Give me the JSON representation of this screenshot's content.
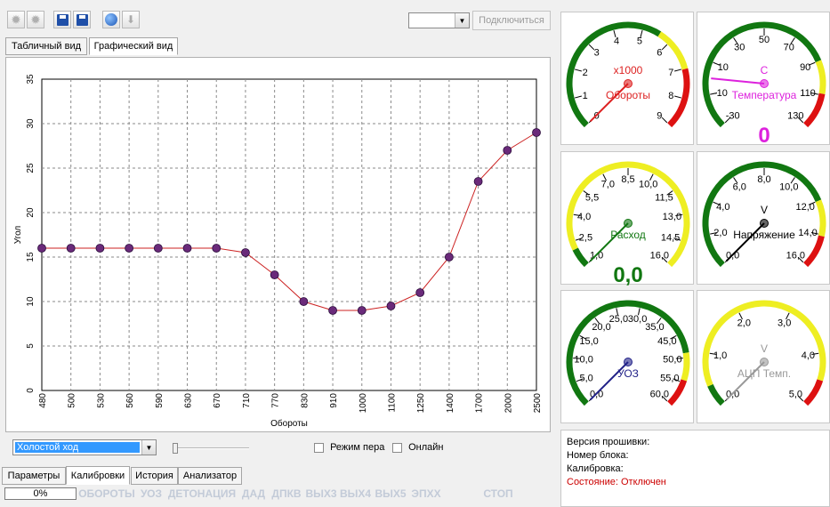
{
  "toolbar": {
    "icons": [
      "gear-left-icon",
      "gear-right-icon",
      "save-icon",
      "save-as-icon",
      "globe-icon",
      "download-icon"
    ],
    "port_value": "",
    "connect_label": "Подключиться"
  },
  "view_tabs": [
    {
      "label": "Табличный вид",
      "active": false
    },
    {
      "label": "Графический вид",
      "active": true
    }
  ],
  "chart_data": {
    "type": "line",
    "xlabel": "Обороты",
    "ylabel": "Угол",
    "x": [
      480,
      500,
      530,
      560,
      590,
      630,
      670,
      710,
      770,
      830,
      910,
      1000,
      1100,
      1250,
      1400,
      1700,
      2000,
      2500
    ],
    "y": [
      16,
      16,
      16,
      16,
      16,
      16,
      16,
      15.5,
      13,
      10,
      9,
      9,
      9.5,
      11,
      15,
      23.5,
      27,
      29
    ],
    "ylim": [
      0,
      35
    ],
    "yticks": [
      0,
      5,
      10,
      15,
      20,
      25,
      30,
      35
    ],
    "grid": true,
    "line_color": "#cc2222",
    "marker_color": "#6a2a7a"
  },
  "chart_controls": {
    "mode_select": "Холостой ход",
    "pen_mode_label": "Режим пера",
    "online_label": "Онлайн"
  },
  "bottom_tabs": [
    {
      "label": "Параметры",
      "active": false
    },
    {
      "label": "Калибровки",
      "active": true
    },
    {
      "label": "История",
      "active": false
    },
    {
      "label": "Анализатор",
      "active": false
    }
  ],
  "statusbar": {
    "progress_text": "0%",
    "progress": 0,
    "indicators": [
      "ОБОРОТЫ",
      "УОЗ",
      "ДЕТОНАЦИЯ",
      "ДАД",
      "ДПКВ",
      "ВЫХ3",
      "ВЫХ4",
      "ВЫХ5",
      "ЭПХХ",
      "СТОП"
    ]
  },
  "gauges": [
    {
      "id": "rpm",
      "label": "Обороты",
      "unit": "x1000",
      "min": 0,
      "max": 9,
      "ticks": [
        "0",
        "1",
        "2",
        "3",
        "4",
        "5",
        "6",
        "7",
        "8",
        "9"
      ],
      "value": 0,
      "readout": "",
      "color": "#dd2222",
      "bands": [
        [
          "#117711",
          0,
          0.62
        ],
        [
          "#eeee22",
          0.62,
          0.78
        ],
        [
          "#dd1111",
          0.78,
          1
        ]
      ]
    },
    {
      "id": "temp",
      "label": "Температура",
      "unit": "C",
      "min": -30,
      "max": 130,
      "ticks": [
        "-30",
        "-10",
        "10",
        "30",
        "50",
        "70",
        "90",
        "110",
        "130"
      ],
      "value": 0,
      "readout": "0",
      "color": "#dd22dd",
      "bands": [
        [
          "#117711",
          0,
          0.75
        ],
        [
          "#eeee22",
          0.75,
          0.87
        ],
        [
          "#dd1111",
          0.87,
          1
        ]
      ]
    },
    {
      "id": "flow",
      "label": "Расход",
      "unit": "",
      "min": 1,
      "max": 16,
      "ticks": [
        "1,0",
        "2,5",
        "4,0",
        "5,5",
        "7,0",
        "8,5",
        "10,0",
        "11,5",
        "13,0",
        "14,5",
        "16,0"
      ],
      "value": 1,
      "readout": "0,0",
      "color": "#117711",
      "bands": [
        [
          "#117711",
          0,
          0.07
        ],
        [
          "#eeee22",
          0.07,
          1
        ]
      ]
    },
    {
      "id": "volt",
      "label": "Напряжение",
      "unit": "V",
      "min": 0,
      "max": 16,
      "ticks": [
        "0,0",
        "2,0",
        "4,0",
        "6,0",
        "8,0",
        "10,0",
        "12,0",
        "14,0",
        "16,0"
      ],
      "value": 0,
      "readout": "",
      "color": "#000000",
      "bands": [
        [
          "#117711",
          0,
          0.75
        ],
        [
          "#eeee22",
          0.75,
          0.88
        ],
        [
          "#dd1111",
          0.88,
          1
        ]
      ]
    },
    {
      "id": "uoz",
      "label": "УОЗ",
      "unit": "",
      "min": 0,
      "max": 60,
      "ticks": [
        "0,0",
        "5,0",
        "10,0",
        "15,0",
        "20,0",
        "25,0",
        "30,0",
        "35,0",
        "45,0",
        "50,0",
        "55,0",
        "60,0"
      ],
      "value": 0,
      "readout": "",
      "color": "#222288",
      "bands": [
        [
          "#117711",
          0,
          0.8
        ],
        [
          "#eeee22",
          0.8,
          0.9
        ],
        [
          "#dd1111",
          0.9,
          1
        ]
      ]
    },
    {
      "id": "adc",
      "label": "АЦП Темп.",
      "unit": "V",
      "min": 0,
      "max": 5,
      "ticks": [
        "0,0",
        "1,0",
        "2,0",
        "3,0",
        "4,0",
        "5,0"
      ],
      "value": 0,
      "readout": "",
      "color": "#999999",
      "bands": [
        [
          "#117711",
          0,
          0.08
        ],
        [
          "#eeee22",
          0.08,
          0.9
        ],
        [
          "#dd1111",
          0.9,
          1
        ]
      ]
    }
  ],
  "info": {
    "firmware_label": "Версия прошивки:",
    "block_label": "Номер блока:",
    "calib_label": "Калибровка:",
    "state_label": "Состояние: Отключен",
    "state_color": "#cc0000"
  }
}
